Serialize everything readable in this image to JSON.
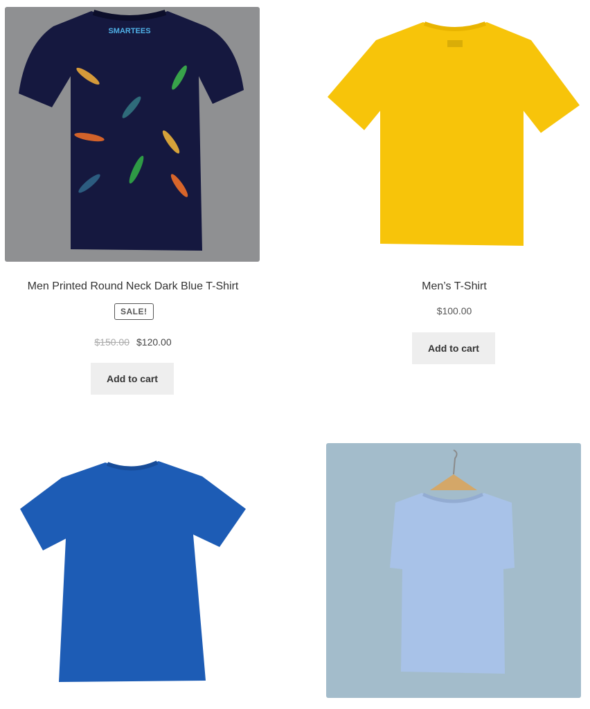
{
  "products": [
    {
      "title": "Men Printed Round Neck Dark Blue T-Shirt",
      "badge": "SALE!",
      "price_old": "$150.00",
      "price": "$120.00",
      "button": "Add to cart",
      "image_brand": "SMARTEES",
      "colors": {
        "bg": "#8f9092",
        "shirt": "#15183f"
      }
    },
    {
      "title": "Men’s T-Shirt",
      "price": "$100.00",
      "button": "Add to cart",
      "colors": {
        "bg": "#ffffff",
        "shirt": "#f7c40a"
      }
    },
    {
      "colors": {
        "bg": "#ffffff",
        "shirt": "#1d5cb5"
      }
    },
    {
      "colors": {
        "bg": "#a3bccb",
        "shirt": "#a8c2e8",
        "hanger": "#d4a768"
      }
    }
  ],
  "colors": {
    "button_bg": "#eeeeee",
    "text": "#333333",
    "muted": "#aaaaaa"
  }
}
